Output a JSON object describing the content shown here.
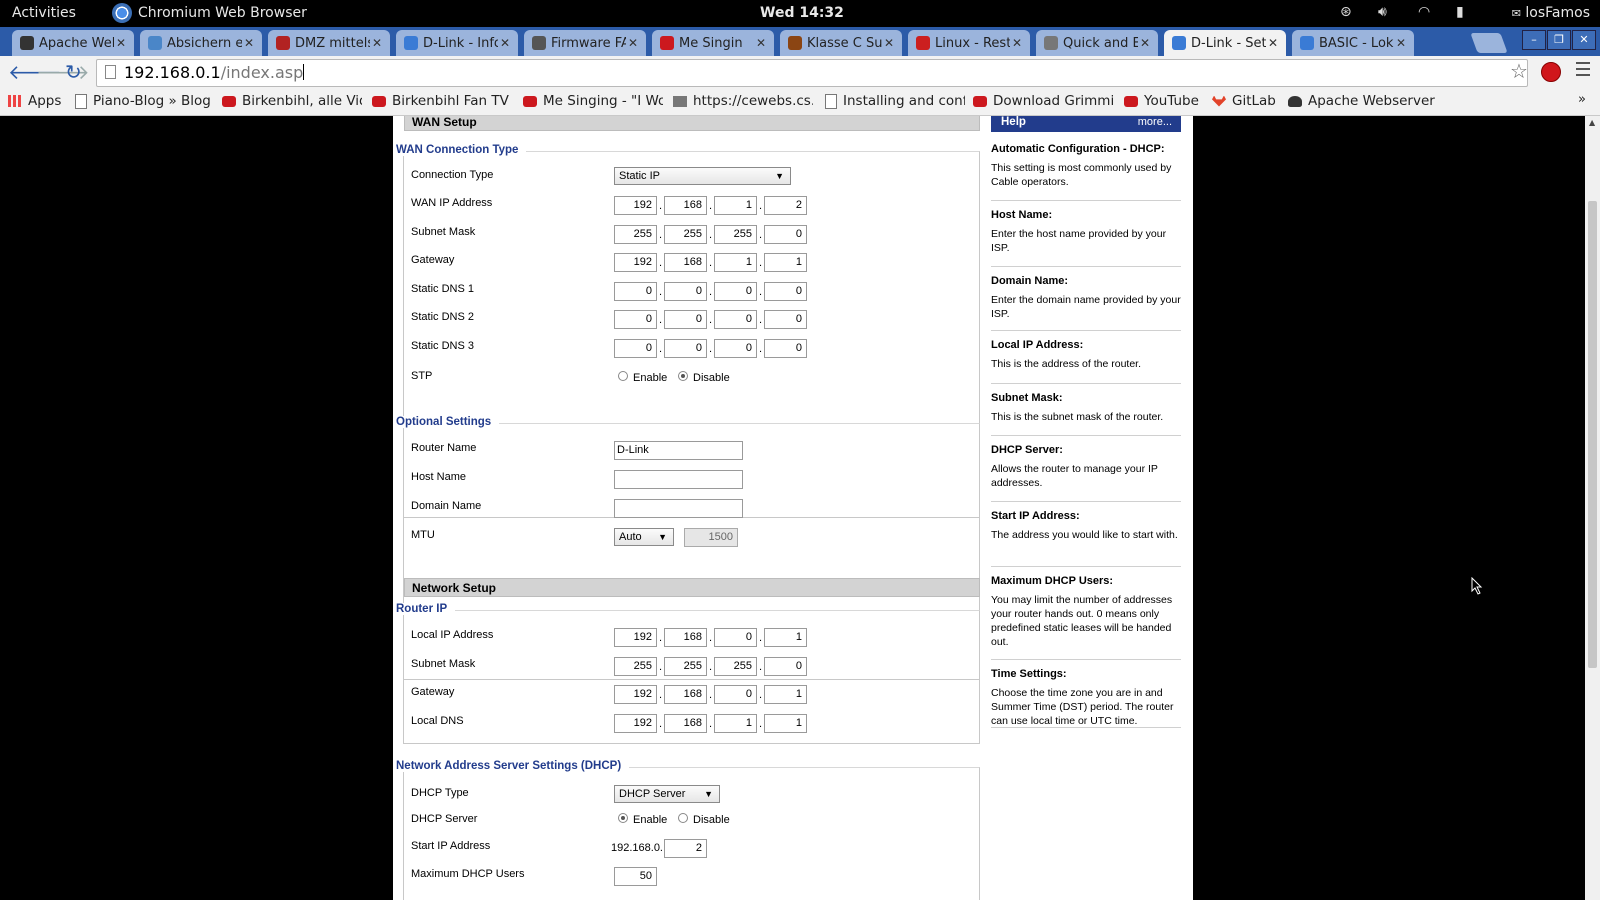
{
  "topbar": {
    "activities": "Activities",
    "app_name": "Chromium Web Browser",
    "clock": "Wed 14:32",
    "user": "losFamos"
  },
  "tabs": [
    {
      "label": "Apache Web",
      "color": "#333333"
    },
    {
      "label": "Absichern ei",
      "color": "#4a86c8"
    },
    {
      "label": "DMZ mittels",
      "color": "#b22222"
    },
    {
      "label": "D-Link - Info",
      "color": "#3a7bd5"
    },
    {
      "label": "Firmware FA",
      "color": "#555555"
    },
    {
      "label": "Me Singin",
      "color": "#cc181e"
    },
    {
      "label": "Klasse C Sul",
      "color": "#8b4513"
    },
    {
      "label": "Linux - Resta",
      "color": "#cc1f1f"
    },
    {
      "label": "Quick and Ea",
      "color": "#777777"
    },
    {
      "label": "D-Link - Setu",
      "color": "#3a7bd5"
    },
    {
      "label": "BASIC - Lok",
      "color": "#3a7bd5"
    }
  ],
  "address_bar": {
    "host": "192.168.0.1",
    "path": "/index.asp"
  },
  "bookmarks": [
    {
      "label": "Apps",
      "icon": "apps-grid-icon"
    },
    {
      "label": "Piano-Blog » Blog",
      "icon": "page-icon"
    },
    {
      "label": "Birkenbihl, alle Vid",
      "icon": "youtube-icon"
    },
    {
      "label": "Birkenbihl Fan TV -",
      "icon": "youtube-icon"
    },
    {
      "label": "Me Singing - \"I Wo",
      "icon": "youtube-icon"
    },
    {
      "label": "https://cewebs.cs.",
      "icon": "site-icon"
    },
    {
      "label": "Installing and confi",
      "icon": "page-icon"
    },
    {
      "label": "Download Grimmie",
      "icon": "youtube-icon"
    },
    {
      "label": "YouTube",
      "icon": "youtube-icon"
    },
    {
      "label": "GitLab",
      "icon": "gitlab-icon"
    },
    {
      "label": "Apache Webserver",
      "icon": "apache-icon"
    }
  ],
  "wan": {
    "section_title": "WAN Setup",
    "group_title": "WAN Connection Type",
    "connection_type_label": "Connection Type",
    "connection_type_value": "Static IP",
    "rows": [
      {
        "label": "WAN IP Address",
        "octets": [
          "192",
          "168",
          "1",
          "2"
        ]
      },
      {
        "label": "Subnet Mask",
        "octets": [
          "255",
          "255",
          "255",
          "0"
        ]
      },
      {
        "label": "Gateway",
        "octets": [
          "192",
          "168",
          "1",
          "1"
        ]
      },
      {
        "label": "Static DNS 1",
        "octets": [
          "0",
          "0",
          "0",
          "0"
        ]
      },
      {
        "label": "Static DNS 2",
        "octets": [
          "0",
          "0",
          "0",
          "0"
        ]
      },
      {
        "label": "Static DNS 3",
        "octets": [
          "0",
          "0",
          "0",
          "0"
        ]
      }
    ],
    "stp_label": "STP",
    "stp_enable": "Enable",
    "stp_disable": "Disable"
  },
  "optional": {
    "group_title": "Optional Settings",
    "router_name_label": "Router Name",
    "router_name_value": "D-Link",
    "host_name_label": "Host Name",
    "host_name_value": "",
    "domain_name_label": "Domain Name",
    "domain_name_value": "",
    "mtu_label": "MTU",
    "mtu_mode": "Auto",
    "mtu_value": "1500"
  },
  "network": {
    "section_title": "Network Setup",
    "group_title": "Router IP",
    "rows": [
      {
        "label": "Local IP Address",
        "octets": [
          "192",
          "168",
          "0",
          "1"
        ]
      },
      {
        "label": "Subnet Mask",
        "octets": [
          "255",
          "255",
          "255",
          "0"
        ]
      },
      {
        "label": "Gateway",
        "octets": [
          "192",
          "168",
          "0",
          "1"
        ]
      },
      {
        "label": "Local DNS",
        "octets": [
          "192",
          "168",
          "1",
          "1"
        ]
      }
    ]
  },
  "dhcp": {
    "group_title": "Network Address Server Settings (DHCP)",
    "type_label": "DHCP Type",
    "type_value": "DHCP Server",
    "server_label": "DHCP Server",
    "server_enable": "Enable",
    "server_disable": "Disable",
    "start_label": "Start IP Address",
    "start_prefix": "192.168.0.",
    "start_value": "2",
    "max_label": "Maximum DHCP Users",
    "max_value": "50"
  },
  "help": {
    "title": "Help",
    "more": "more...",
    "items": [
      {
        "title": "Automatic Configuration - DHCP:",
        "text": "This setting is most commonly used by Cable operators."
      },
      {
        "title": "Host Name:",
        "text": "Enter the host name provided by your ISP."
      },
      {
        "title": "Domain Name:",
        "text": "Enter the domain name provided by your ISP."
      },
      {
        "title": "Local IP Address:",
        "text": "This is the address of the router."
      },
      {
        "title": "Subnet Mask:",
        "text": "This is the subnet mask of the router."
      },
      {
        "title": "DHCP Server:",
        "text": "Allows the router to manage your IP addresses."
      },
      {
        "title": "Start IP Address:",
        "text": "The address you would like to start with."
      },
      {
        "title": "Maximum DHCP Users:",
        "text": "You may limit the number of addresses your router hands out. 0 means only predefined static leases will be handed out."
      },
      {
        "title": "Time Settings:",
        "text": "Choose the time zone you are in and Summer Time (DST) period. The router can use local time or UTC time."
      }
    ]
  }
}
